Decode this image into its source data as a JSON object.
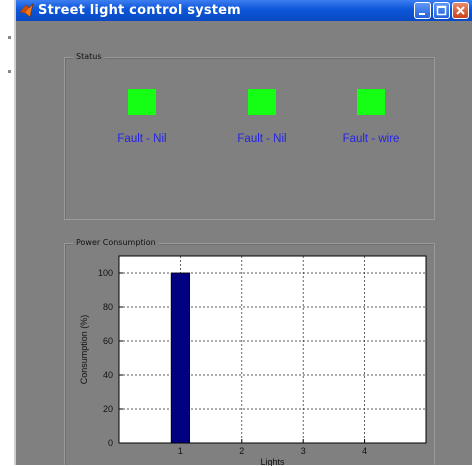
{
  "window": {
    "title": "Street light control system",
    "buttons": [
      "minimize",
      "maximize",
      "close"
    ]
  },
  "status": {
    "title": "Status",
    "indicators": [
      {
        "label": "Fault - Nil",
        "color": "#14ff14"
      },
      {
        "label": "Fault - Nil",
        "color": "#14ff14"
      },
      {
        "label": "Fault - wire",
        "color": "#14ff14"
      }
    ]
  },
  "power": {
    "title": "Power Consumption"
  },
  "chart_data": {
    "type": "bar",
    "x": [
      1
    ],
    "values": [
      100
    ],
    "xlabel": "Lights",
    "ylabel": "Consumption (%)",
    "xticks": [
      "1",
      "2",
      "3",
      "4"
    ],
    "yticks": [
      "0",
      "20",
      "40",
      "60",
      "80",
      "100"
    ],
    "xlim": [
      0,
      5
    ],
    "ylim": [
      0,
      110
    ],
    "grid": true,
    "bar_color": "#000080"
  }
}
